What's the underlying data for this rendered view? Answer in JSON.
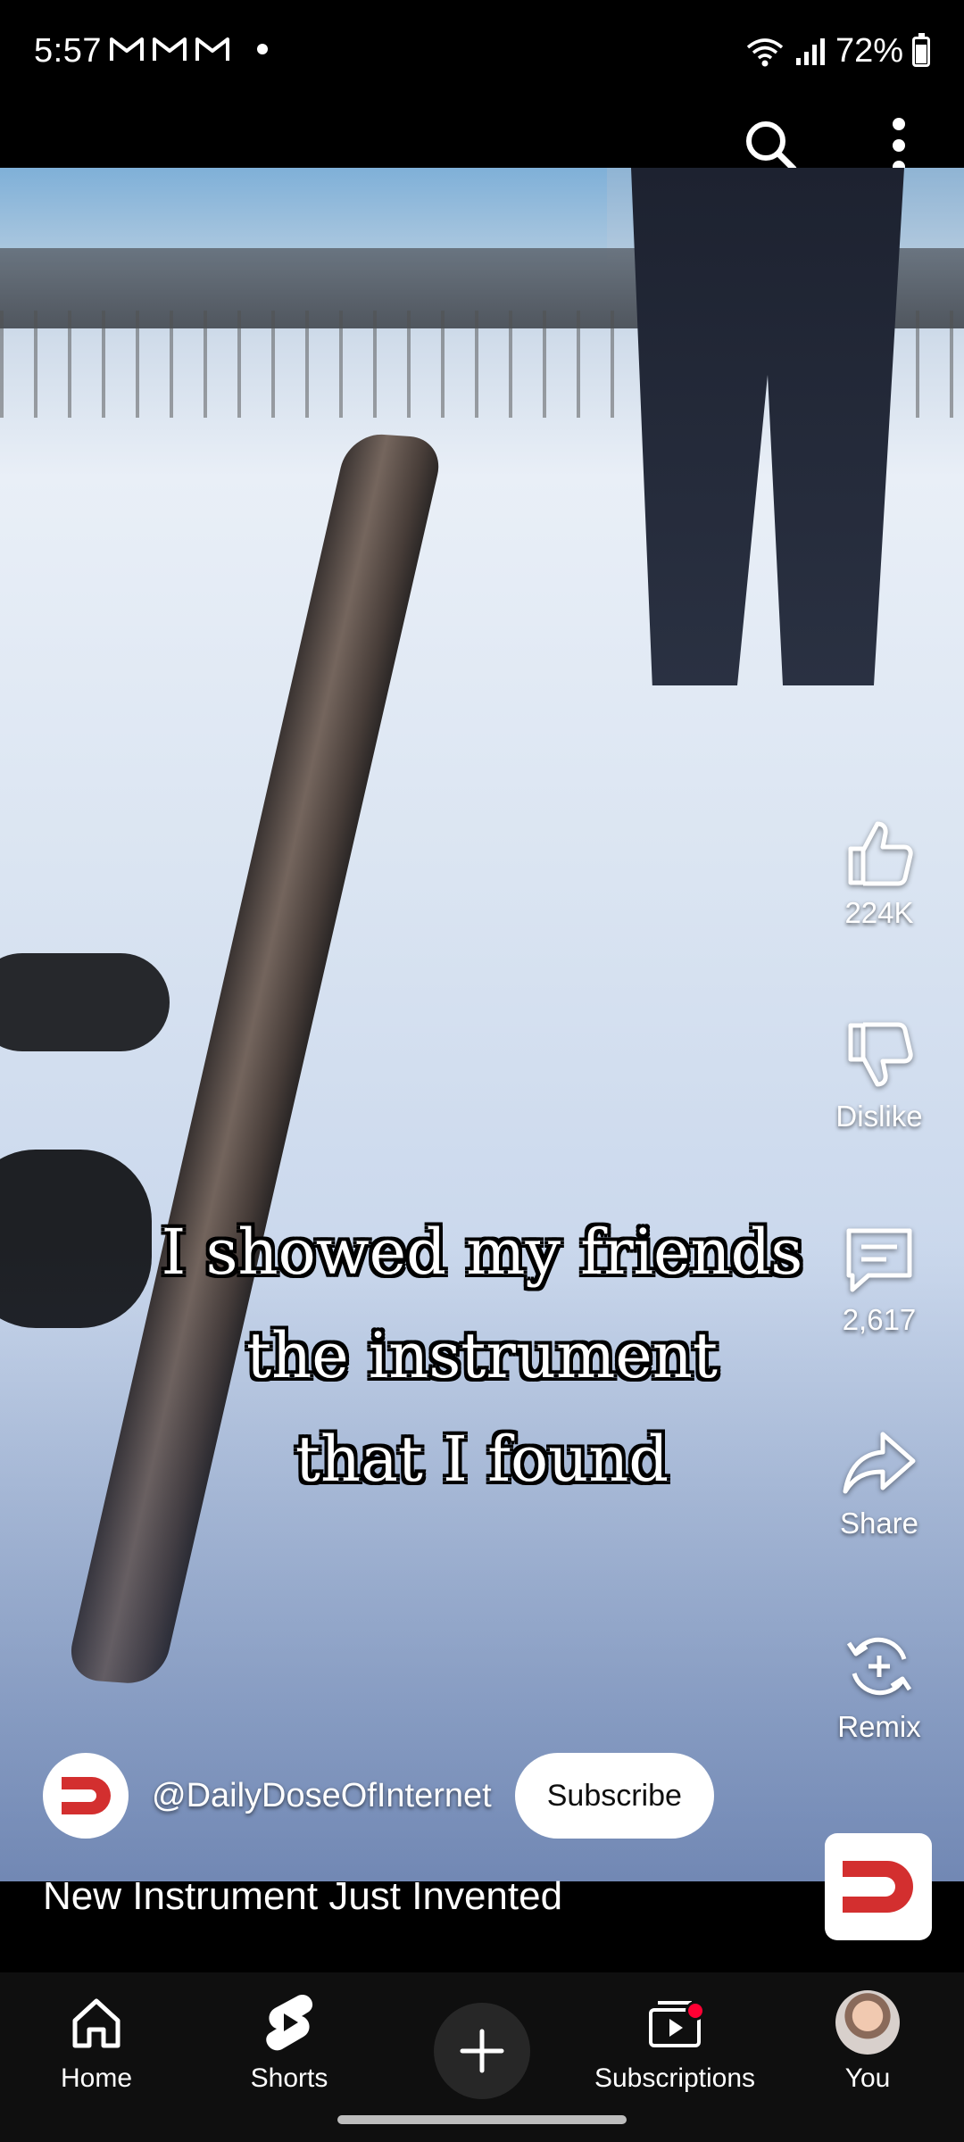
{
  "status_bar": {
    "time": "5:57",
    "battery": "72%",
    "notification_icons": [
      "gmail-icon",
      "gmail-icon",
      "gmail-icon",
      "dot-icon"
    ]
  },
  "top_bar": {
    "icons": [
      "search-icon",
      "more-vert-icon"
    ]
  },
  "video": {
    "caption_lines": [
      "I showed my friends",
      "the instrument",
      "that I found"
    ]
  },
  "actions": {
    "like_count": "224K",
    "dislike_label": "Dislike",
    "comment_count": "2,617",
    "share_label": "Share",
    "remix_label": "Remix"
  },
  "channel": {
    "handle": "@DailyDoseOfInternet",
    "subscribe_label": "Subscribe",
    "brand_color": "#d32f2f"
  },
  "title": "New Instrument Just Invented",
  "bottom_nav": {
    "home": "Home",
    "shorts": "Shorts",
    "subscriptions": "Subscriptions",
    "you": "You"
  }
}
